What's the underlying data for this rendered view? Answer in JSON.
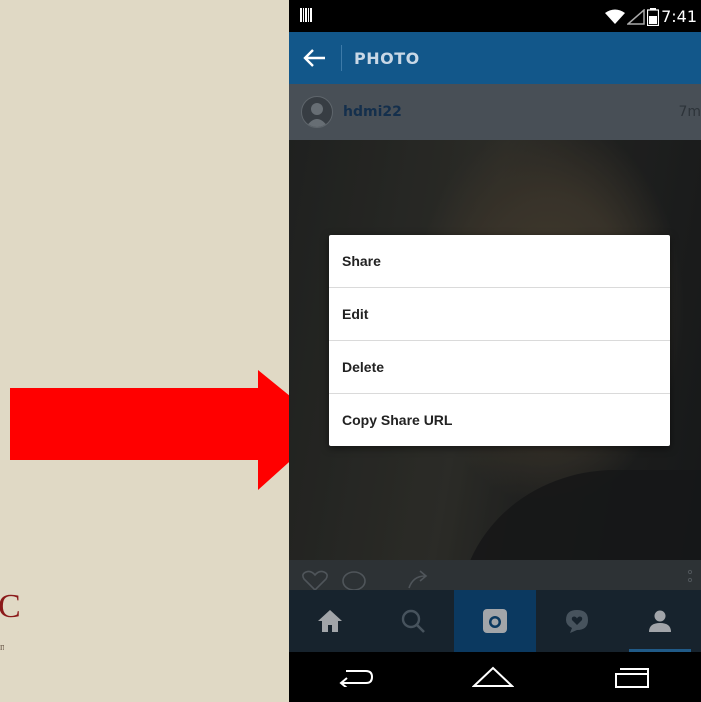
{
  "status_bar": {
    "time": "7:41"
  },
  "app_bar": {
    "title": "PHOTO"
  },
  "post": {
    "username": "hdmi22",
    "time": "7m"
  },
  "menu": {
    "items": [
      {
        "label": "Share"
      },
      {
        "label": "Edit"
      },
      {
        "label": "Delete"
      },
      {
        "label": "Copy Share URL"
      }
    ]
  },
  "bottom_nav": [
    "home-icon",
    "search-icon",
    "camera-icon",
    "activity-icon",
    "profile-icon"
  ],
  "android_nav": [
    "back-icon",
    "home-outline-icon",
    "recents-icon"
  ],
  "slide": {
    "logo_letter": "C",
    "logo_sub": "n"
  },
  "colors": {
    "slide_background": "#e0d9c5",
    "arrow": "#ff0000",
    "app_bar": "#12578a",
    "bottom_nav": "#1f2f3d",
    "active_nav": "#0f4d80"
  }
}
